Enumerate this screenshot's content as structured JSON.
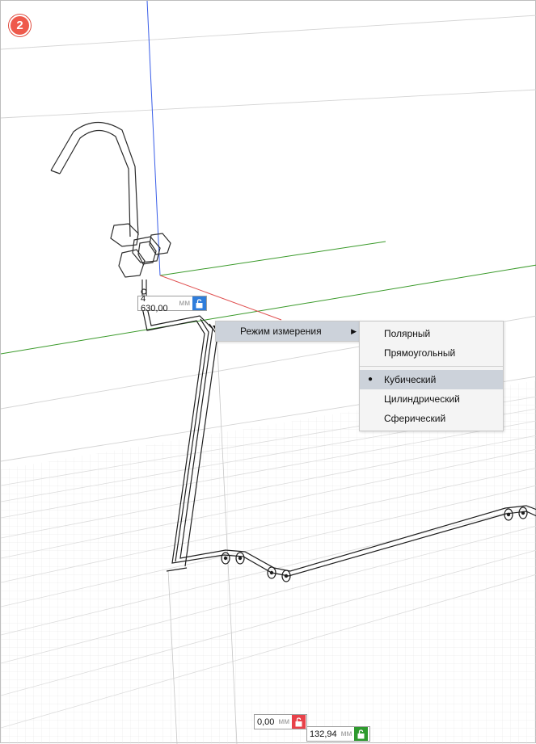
{
  "step_badge": "2",
  "dimension_main": {
    "value": "4 630,00",
    "unit": "мм"
  },
  "dimension_bottom_left": {
    "value": "0,00",
    "unit": "мм"
  },
  "dimension_bottom_right": {
    "value": "132,94",
    "unit": "мм"
  },
  "context_menu": {
    "parent_item": "Режим измерения",
    "submenu_items": [
      {
        "label": "Полярный"
      },
      {
        "label": "Прямоугольный"
      },
      {
        "label": "Кубический",
        "selected": true
      },
      {
        "label": "Цилиндрический"
      },
      {
        "label": "Сферический"
      }
    ]
  },
  "colors": {
    "badge": "#ee5a4c",
    "axis_x": "#e05050",
    "axis_y": "#3a9a2a",
    "axis_z": "#3a5ee8",
    "lock_open": "#2f7ddb",
    "lock_red": "#e8424a",
    "lock_green": "#2e9a2e",
    "menu_highlight": "#ccd2da"
  },
  "icons": [
    "lock-open-icon",
    "submenu-arrow-icon",
    "radio-bullet-icon"
  ]
}
